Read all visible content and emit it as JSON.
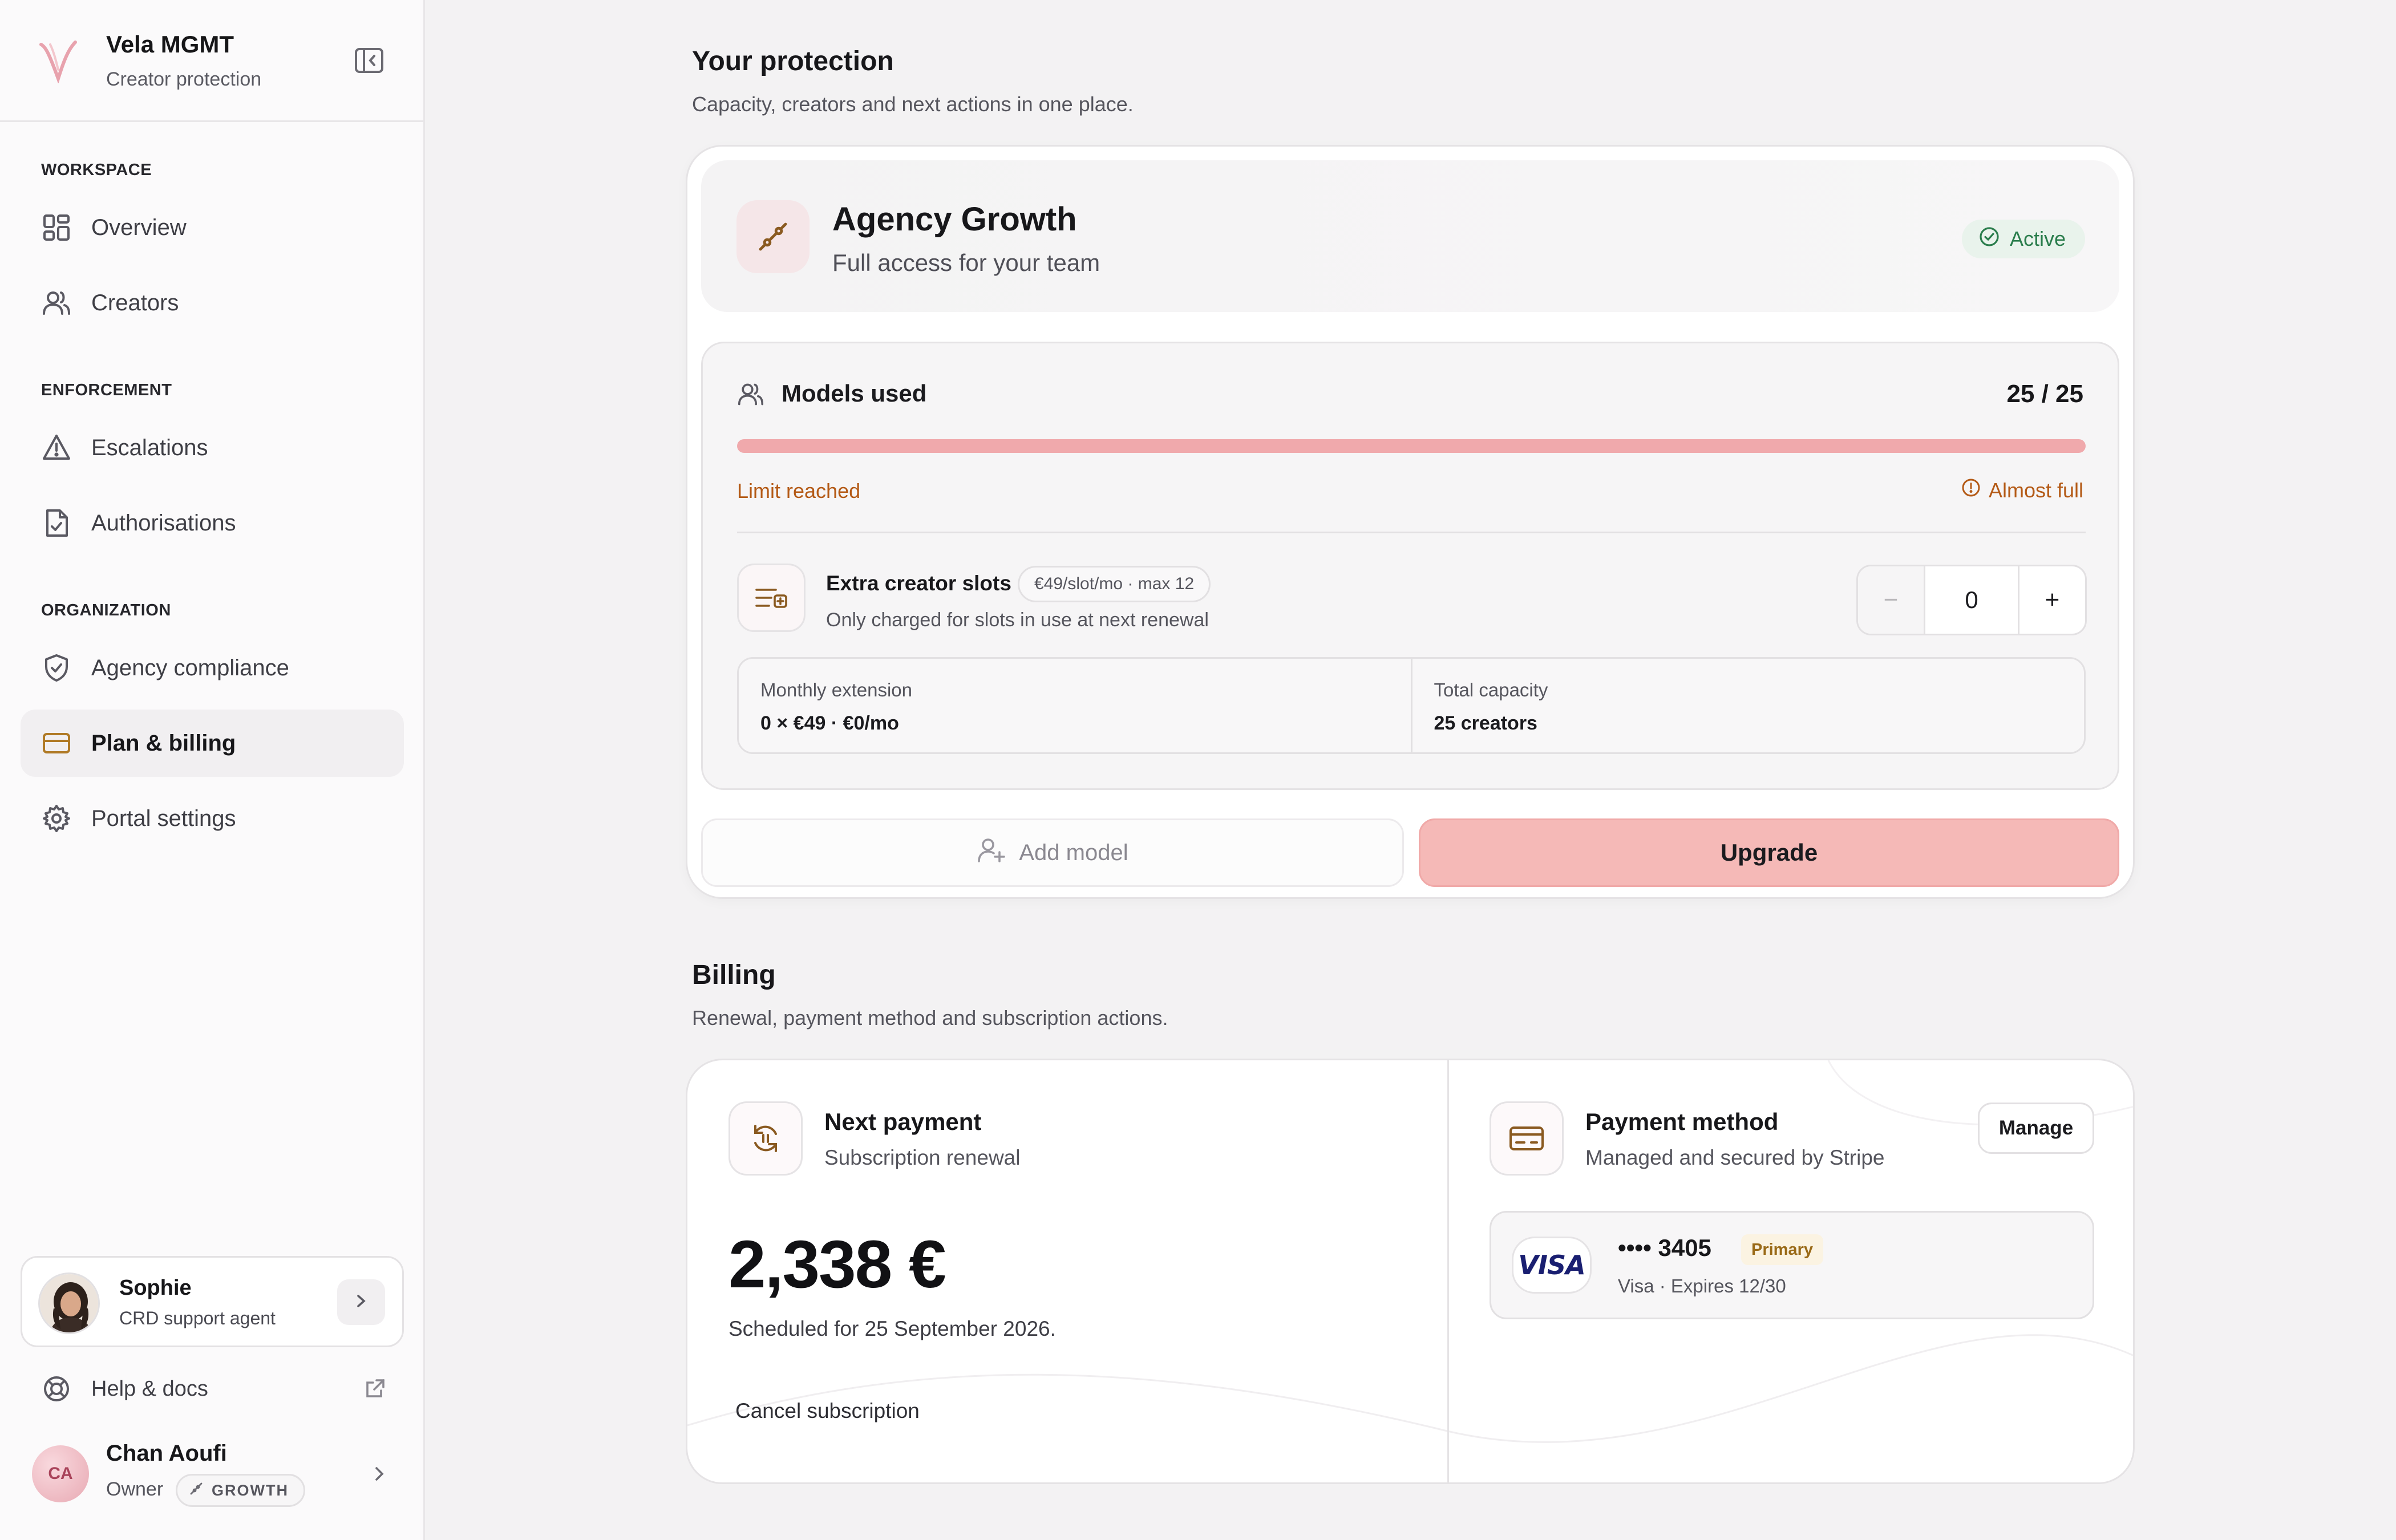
{
  "brand": {
    "name": "Vela MGMT",
    "subtitle": "Creator protection"
  },
  "sidebar": {
    "groups": [
      {
        "label": "WORKSPACE",
        "items": [
          {
            "label": "Overview",
            "icon": "grid-icon"
          },
          {
            "label": "Creators",
            "icon": "users-icon"
          }
        ]
      },
      {
        "label": "ENFORCEMENT",
        "items": [
          {
            "label": "Escalations",
            "icon": "warning-icon"
          },
          {
            "label": "Authorisations",
            "icon": "file-check-icon"
          }
        ]
      },
      {
        "label": "ORGANIZATION",
        "items": [
          {
            "label": "Agency compliance",
            "icon": "shield-icon"
          },
          {
            "label": "Plan & billing",
            "icon": "credit-card-icon",
            "active": true
          },
          {
            "label": "Portal settings",
            "icon": "gear-icon"
          }
        ]
      }
    ],
    "agent": {
      "name": "Sophie",
      "role": "CRD support agent"
    },
    "help": {
      "label": "Help & docs"
    },
    "user": {
      "initials": "CA",
      "name": "Chan Aoufi",
      "role": "Owner",
      "badge": "GROWTH"
    }
  },
  "protection": {
    "title": "Your protection",
    "subtitle": "Capacity, creators and next actions in one place.",
    "plan": {
      "name": "Agency Growth",
      "description": "Full access for your team",
      "status": "Active",
      "status_color": "#2a7d4c"
    },
    "usage": {
      "title": "Models used",
      "count": "25 / 25",
      "used": 25,
      "limit": 25,
      "limit_text": "Limit reached",
      "warning": "Almost full",
      "warning_color": "#b45a16"
    },
    "slots": {
      "title": "Extra creator slots",
      "price": "€49/slot/mo · max 12",
      "note": "Only charged for slots in use at next renewal",
      "minus": "−",
      "value": "0",
      "plus": "+"
    },
    "metrics": [
      {
        "label": "Monthly extension",
        "value": "0 × €49 · €0/mo"
      },
      {
        "label": "Total capacity",
        "value": "25 creators"
      }
    ],
    "add_model_label": "Add model",
    "upgrade_label": "Upgrade",
    "accent_color": "#f5b9b7"
  },
  "billing": {
    "title": "Billing",
    "subtitle": "Renewal, payment method and subscription actions.",
    "next_payment": {
      "title": "Next payment",
      "subtitle": "Subscription renewal",
      "amount": "2,338 €",
      "scheduled": "Scheduled for 25 September 2026.",
      "cancel_label": "Cancel subscription"
    },
    "payment_method": {
      "title": "Payment method",
      "subtitle": "Managed and secured by Stripe",
      "manage_label": "Manage",
      "card": {
        "brand": "VISA",
        "number": "•••• 3405",
        "badge": "Primary",
        "expiry": "Visa · Expires 12/30"
      }
    }
  }
}
